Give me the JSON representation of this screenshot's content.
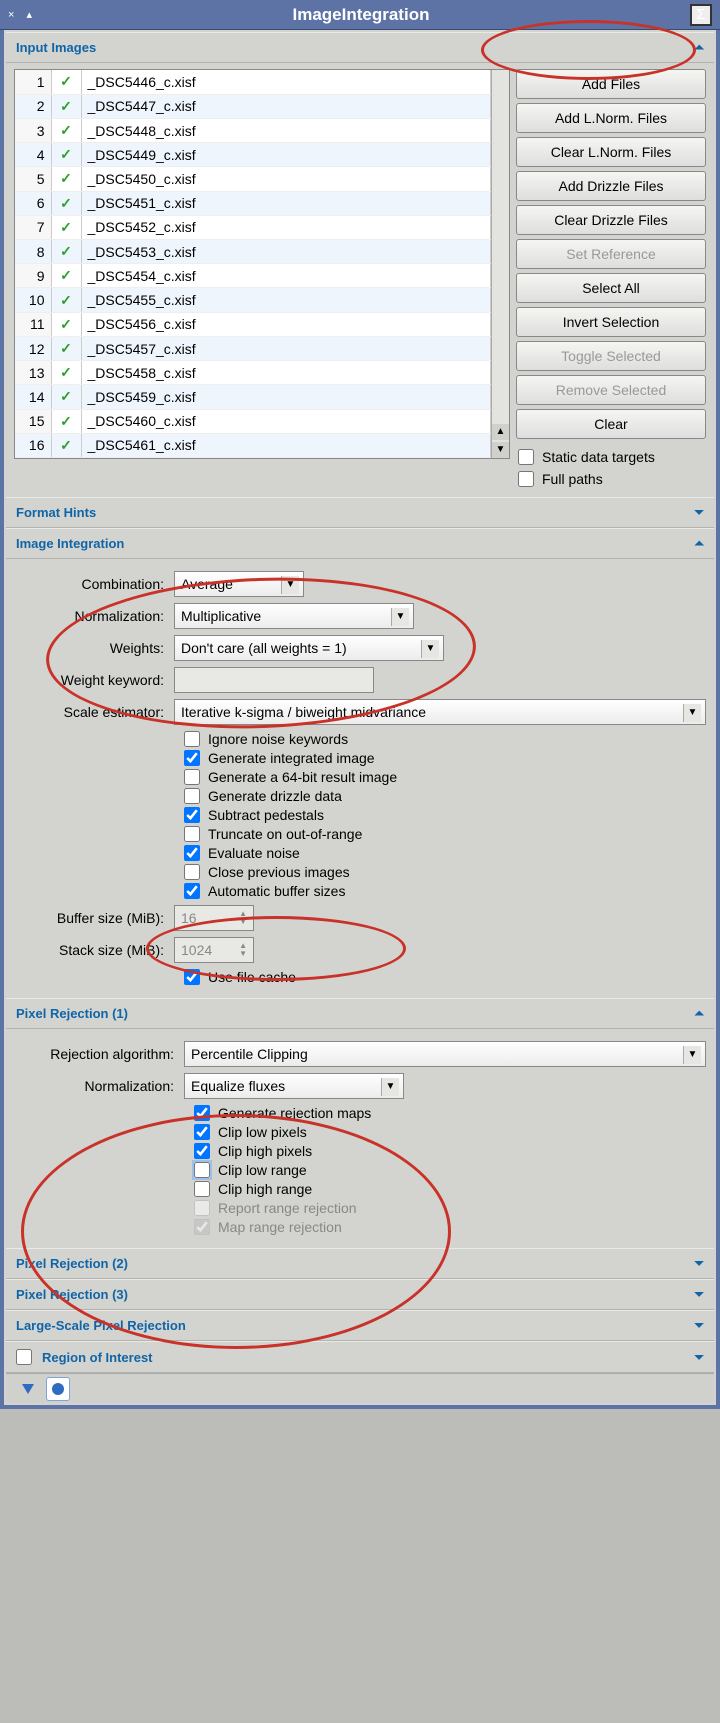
{
  "title": "ImageIntegration",
  "sections": {
    "input_images": "Input Images",
    "format_hints": "Format Hints",
    "image_integration": "Image Integration",
    "pixel_rejection_1": "Pixel Rejection (1)",
    "pixel_rejection_2": "Pixel Rejection (2)",
    "pixel_rejection_3": "Pixel Rejection (3)",
    "large_scale": "Large-Scale Pixel Rejection",
    "roi": "Region of Interest"
  },
  "files": [
    {
      "idx": "1",
      "name": "_DSC5446_c.xisf"
    },
    {
      "idx": "2",
      "name": "_DSC5447_c.xisf"
    },
    {
      "idx": "3",
      "name": "_DSC5448_c.xisf"
    },
    {
      "idx": "4",
      "name": "_DSC5449_c.xisf"
    },
    {
      "idx": "5",
      "name": "_DSC5450_c.xisf"
    },
    {
      "idx": "6",
      "name": "_DSC5451_c.xisf"
    },
    {
      "idx": "7",
      "name": "_DSC5452_c.xisf"
    },
    {
      "idx": "8",
      "name": "_DSC5453_c.xisf"
    },
    {
      "idx": "9",
      "name": "_DSC5454_c.xisf"
    },
    {
      "idx": "10",
      "name": "_DSC5455_c.xisf"
    },
    {
      "idx": "11",
      "name": "_DSC5456_c.xisf"
    },
    {
      "idx": "12",
      "name": "_DSC5457_c.xisf"
    },
    {
      "idx": "13",
      "name": "_DSC5458_c.xisf"
    },
    {
      "idx": "14",
      "name": "_DSC5459_c.xisf"
    },
    {
      "idx": "15",
      "name": "_DSC5460_c.xisf"
    },
    {
      "idx": "16",
      "name": "_DSC5461_c.xisf"
    }
  ],
  "file_buttons": {
    "add_files": "Add Files",
    "add_lnorm": "Add L.Norm. Files",
    "clear_lnorm": "Clear L.Norm. Files",
    "add_drizzle": "Add Drizzle Files",
    "clear_drizzle": "Clear Drizzle Files",
    "set_reference": "Set Reference",
    "select_all": "Select All",
    "invert_selection": "Invert Selection",
    "toggle_selected": "Toggle Selected",
    "remove_selected": "Remove Selected",
    "clear": "Clear"
  },
  "file_opts": {
    "static_targets": "Static data targets",
    "full_paths": "Full paths"
  },
  "integration": {
    "combination_label": "Combination:",
    "combination_value": "Average",
    "normalization_label": "Normalization:",
    "normalization_value": "Multiplicative",
    "weights_label": "Weights:",
    "weights_value": "Don't care (all weights = 1)",
    "weight_keyword_label": "Weight keyword:",
    "weight_keyword_value": "",
    "scale_estimator_label": "Scale estimator:",
    "scale_estimator_value": "Iterative k-sigma / biweight midvariance",
    "checks": {
      "ignore_noise": "Ignore noise keywords",
      "gen_integrated": "Generate integrated image",
      "gen_64bit": "Generate a 64-bit result image",
      "gen_drizzle": "Generate drizzle data",
      "subtract_pedestals": "Subtract pedestals",
      "truncate": "Truncate on out-of-range",
      "eval_noise": "Evaluate noise",
      "close_prev": "Close previous images",
      "auto_buffer": "Automatic buffer sizes",
      "use_file_cache": "Use file cache"
    },
    "buffer_size_label": "Buffer size (MiB):",
    "buffer_size_value": "16",
    "stack_size_label": "Stack size (MiB):",
    "stack_size_value": "1024"
  },
  "rejection1": {
    "algorithm_label": "Rejection algorithm:",
    "algorithm_value": "Percentile Clipping",
    "normalization_label": "Normalization:",
    "normalization_value": "Equalize fluxes",
    "checks": {
      "gen_rejection_maps": "Generate rejection maps",
      "clip_low_pixels": "Clip low pixels",
      "clip_high_pixels": "Clip high pixels",
      "clip_low_range": "Clip low range",
      "clip_high_range": "Clip high range",
      "report_range": "Report range rejection",
      "map_range": "Map range rejection"
    }
  }
}
